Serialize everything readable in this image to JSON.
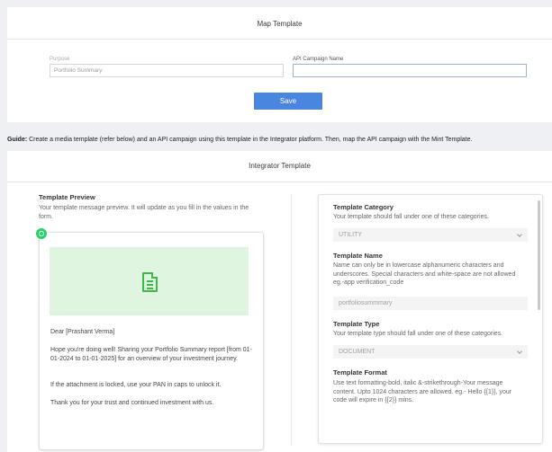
{
  "map_template": {
    "title": "Map Template",
    "purpose_label": "Purpose",
    "purpose_value": "Portfolio Summary",
    "api_campaign_label": "API Campaign Name",
    "api_campaign_value": "",
    "save_label": "Save"
  },
  "guide": {
    "prefix": "Guide:",
    "text": " Create a media template (refer below) and an API campaign using this template in the Integrator platform. Then, map the API campaign with the Mint Template."
  },
  "integrator": {
    "title": "Integrator Template",
    "preview": {
      "title": "Template Preview",
      "subtitle": "Your template message preview. It will update as you fill in the  values in the form.",
      "messages": [
        "Dear [Prashant Verma]",
        "Hope you're doing well! Sharing your Portfolio Summary report [from 01-01-2024 to 01-01-2025] for an overview of your investment journey.",
        "If the attachment is locked, use your PAN in caps to unlock it.",
        "Thank you for your trust and continued investment with us."
      ]
    },
    "form": {
      "category_title": "Template Category",
      "category_desc": "Your template should fall under one of these categories.",
      "category_value": "UTILITY",
      "name_title": "Template Name",
      "name_desc": "Name can only be in lowercase alphanumeric characters and underscores. Special characters and white-space are not allowed eg.-app verification_code",
      "name_value": "portfoliosummmary",
      "type_title": "Template Type",
      "type_desc": "Your template type should fall under one of these categories.",
      "type_value": "DOCUMENT",
      "format_title": "Template Format",
      "format_desc": "Use text formatting-bold, italic &-strikethrough-Your message content. Upto 1024 characters are allowed. eg.- Hello {{1}}, your code will expire in {{2}} mins."
    }
  },
  "icons": {
    "whatsapp": "whatsapp-icon",
    "document": "document-icon",
    "chevron": "chevron-down-icon"
  },
  "colors": {
    "accent": "#4a86e0",
    "whatsapp": "#25d366",
    "doc_green": "#3fb84a"
  }
}
